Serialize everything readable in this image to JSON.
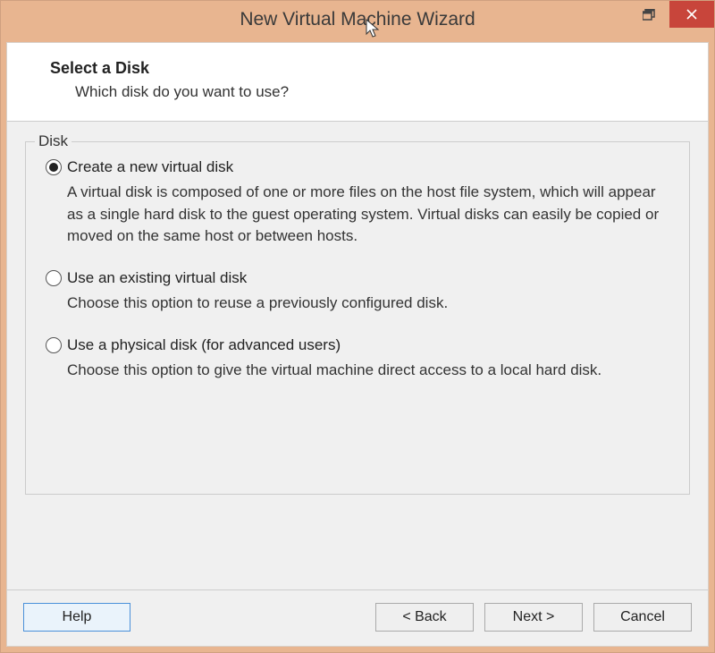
{
  "window": {
    "title": "New Virtual Machine Wizard"
  },
  "header": {
    "title": "Select a Disk",
    "subtitle": "Which disk do you want to use?"
  },
  "groupbox": {
    "legend": "Disk"
  },
  "options": [
    {
      "label": "Create a new virtual disk",
      "description": "A virtual disk is composed of one or more files on the host file system, which will appear as a single hard disk to the guest operating system. Virtual disks can easily be copied or moved on the same host or between hosts.",
      "selected": true
    },
    {
      "label": "Use an existing virtual disk",
      "description": "Choose this option to reuse a previously configured disk.",
      "selected": false
    },
    {
      "label": "Use a physical disk (for advanced users)",
      "description": "Choose this option to give the virtual machine direct access to a local hard disk.",
      "selected": false
    }
  ],
  "buttons": {
    "help": "Help",
    "back": "< Back",
    "next": "Next >",
    "cancel": "Cancel"
  }
}
